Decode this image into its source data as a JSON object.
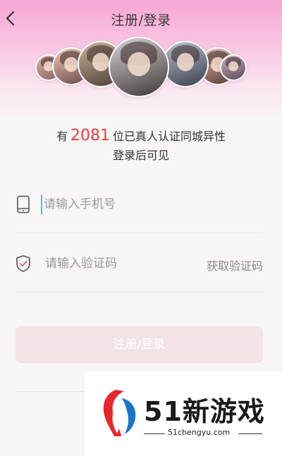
{
  "header": {
    "title": "注册/登录",
    "back_icon": "chevron-left-icon"
  },
  "avatars": [
    {
      "name": "avatar-1",
      "colors": [
        "#d8b4a6",
        "#8a6a64"
      ]
    },
    {
      "name": "avatar-2",
      "colors": [
        "#f0c9b7",
        "#6b4b4a"
      ]
    },
    {
      "name": "avatar-3",
      "colors": [
        "#c9b59a",
        "#4d3f35"
      ]
    },
    {
      "name": "avatar-4",
      "colors": [
        "#d9d2d6",
        "#3d3838"
      ]
    },
    {
      "name": "avatar-5",
      "colors": [
        "#b9c2cf",
        "#3a3f4c"
      ]
    },
    {
      "name": "avatar-6",
      "colors": [
        "#e5c3b4",
        "#5a3a33"
      ]
    },
    {
      "name": "avatar-7",
      "colors": [
        "#c9b1c4",
        "#5c4a57"
      ]
    }
  ],
  "promo": {
    "prefix": "有",
    "count": "2081",
    "suffix": "位已真人认证同城异性",
    "subline": "登录后可见",
    "count_color": "#f03e3e"
  },
  "form": {
    "phone_placeholder": "请输入手机号",
    "code_placeholder": "请输入验证码",
    "get_code_label": "获取验证码",
    "submit_label": "注册/登录",
    "phone_icon": "phone-icon",
    "code_icon": "shield-check-icon"
  },
  "watermark": {
    "title": "51新游戏",
    "url": "51chengyu.com"
  }
}
